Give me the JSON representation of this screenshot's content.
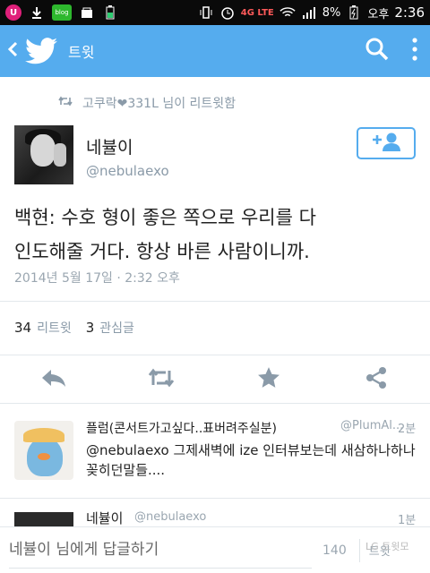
{
  "statusbar": {
    "battery_percent": "8%",
    "network": "4G LTE",
    "ampm": "오후",
    "time": "2:36",
    "blog_label": "blog"
  },
  "appbar": {
    "title": "트윗",
    "back_icon": "chevron-left-icon",
    "search_icon": "search-icon",
    "menu_icon": "more-vertical-icon"
  },
  "tweet": {
    "retweeted_by": "고쿠락❤331L 님이 리트윗함",
    "author_name": "네뷸이",
    "author_handle": "@nebulaexo",
    "text_line1": "백현: 수호 형이 좋은 쪽으로 우리를 다",
    "text_line2": "인도해줄 거다. 항상 바른 사람이니까.",
    "date": "2014년 5월 17일 · 2:32 오후",
    "retweet_count": "34",
    "retweet_label": "리트윗",
    "favorite_count": "3",
    "favorite_label": "관심글"
  },
  "replies": [
    {
      "name": "플럼(콘서트가고싶다..표버려주실분)",
      "handle": "@PlumAl...",
      "time": "2분",
      "text": "@nebulaexo 그제새벽에 ize 인터뷰보는데 새삼하나하나꽂히던말들...."
    },
    {
      "name": "네뷸이",
      "handle": "@nebulaexo",
      "time": "1분"
    }
  ],
  "compose": {
    "placeholder": "네뷸이 님에게 답글하기",
    "counter": "140",
    "tweet_button": "트윗"
  },
  "watermark": "LG 트윗모",
  "colors": {
    "accent": "#55acee",
    "muted": "#8a9aa8"
  }
}
